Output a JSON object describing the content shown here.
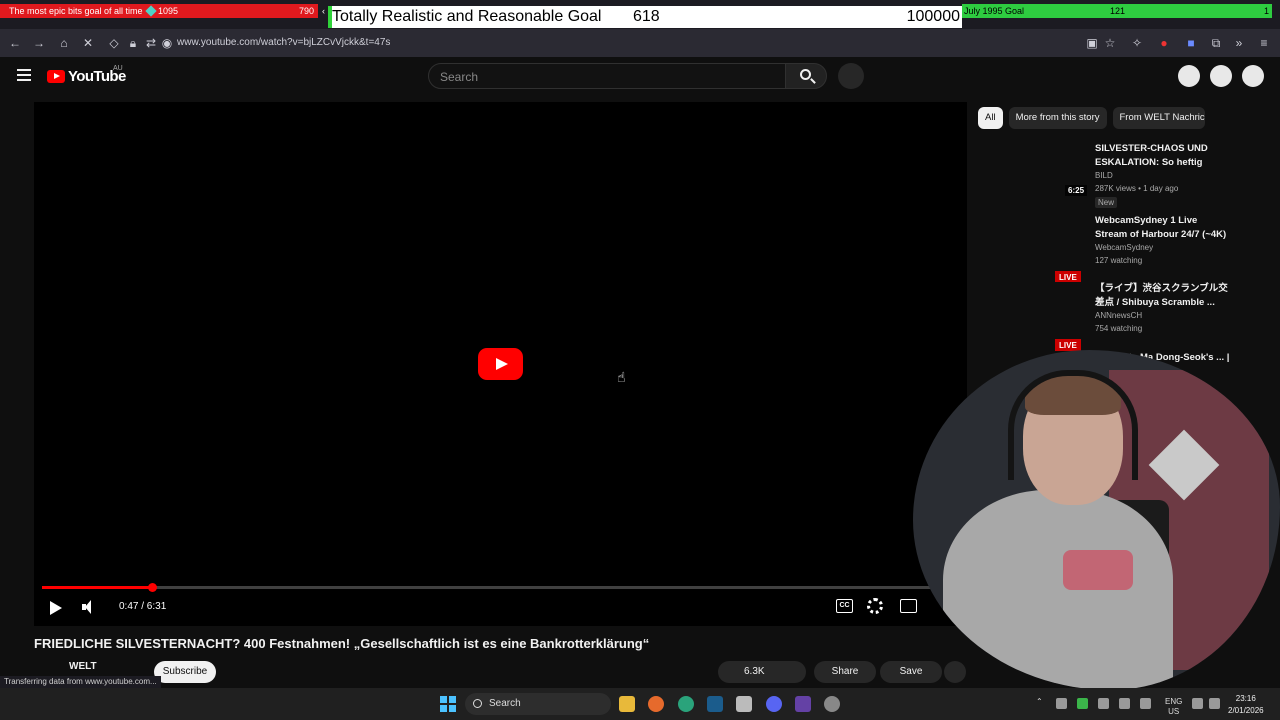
{
  "overlay": {
    "left": {
      "text": "The most epic bits goal of all time",
      "value1": "1095",
      "value2": "790"
    },
    "mid": {
      "text": "Totally Realistic and Reasonable Goal",
      "value1": "618",
      "value2": "100000"
    },
    "right": {
      "text": "July 1995 Goal",
      "value1": "121",
      "value2": "1"
    }
  },
  "browser": {
    "url": "www.youtube.com/watch?v=bjLZCvVjckk&t=47s"
  },
  "header": {
    "logo_text": "YouTube",
    "country": "AU",
    "search_placeholder": "Search"
  },
  "player": {
    "time": "0:47 / 6:31",
    "progress_fraction": 0.1201,
    "cc_label": "CC"
  },
  "video": {
    "title": "FRIEDLICHE SILVESTERNACHT? 400 Festnahmen! „Gesellschaftlich ist es eine Bankrotterklärung“",
    "channel": "WELT",
    "subscribe_label": "Subscribe",
    "likes": "6.3K",
    "share_label": "Share",
    "save_label": "Save"
  },
  "status_text": "Transferring data from www.youtube.com...",
  "chips": [
    "All",
    "More from this story",
    "From WELT Nachrichten"
  ],
  "recommendations": [
    {
      "title": "SILVESTER-CHAOS UND ESKALATION: So heftig feierte...",
      "channel": "BILD",
      "meta": "287K views • 1 day ago",
      "badge": "New",
      "duration": "6:25",
      "live": ""
    },
    {
      "title": "WebcamSydney 1 Live Stream of Harbour 24/7 (~4K)",
      "channel": "WebcamSydney",
      "meta": "127 watching",
      "badge": "",
      "duration": "",
      "live": "LIVE"
    },
    {
      "title": "【ライブ】渋谷スクランブル交差点 / Shibuya Scramble ...",
      "channel": "ANNnewsCH",
      "meta": "754 watching",
      "badge": "",
      "duration": "",
      "live": "LIVE"
    },
    {
      "title": "...'t waste Ma Dong-Seok's ... | Korean ...",
      "channel": "",
      "meta": "",
      "badge": "",
      "duration": "",
      "live": ""
    }
  ],
  "taskbar": {
    "search_label": "Search",
    "lang": "ENG",
    "region": "US",
    "time": "23:16",
    "date": "2/01/2026"
  },
  "colors": {
    "yt_red": "#ff0000",
    "bg": "#0f0f0f",
    "goal_red": "#e0191e",
    "goal_green": "#2ecc40"
  }
}
